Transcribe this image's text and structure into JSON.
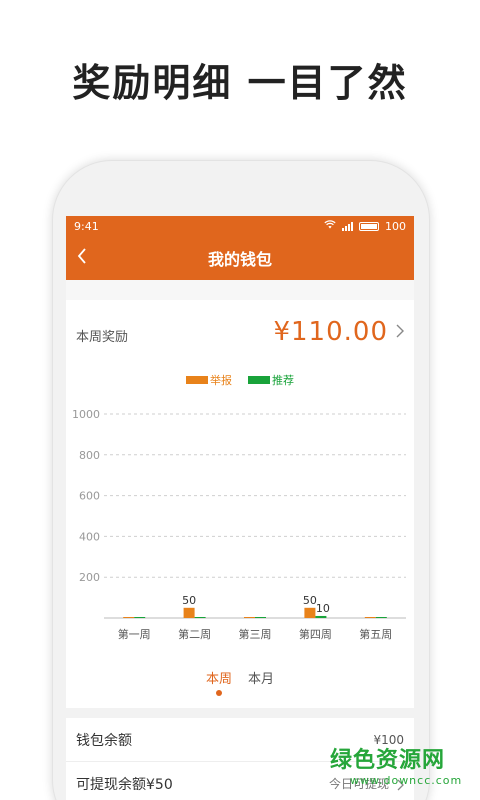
{
  "headline": "奖励明细 一目了然",
  "status_bar": {
    "time": "9:41",
    "battery": "100"
  },
  "nav": {
    "title": "我的钱包"
  },
  "reward": {
    "label": "本周奖励",
    "amount": "¥110.00"
  },
  "chart_data": {
    "type": "bar",
    "categories": [
      "第一周",
      "第二周",
      "第三周",
      "第四周",
      "第五周"
    ],
    "series": [
      {
        "name": "举报",
        "values": [
          0,
          50,
          0,
          50,
          0
        ],
        "color": "#e8821a"
      },
      {
        "name": "推荐",
        "values": [
          0,
          0,
          0,
          10,
          0
        ],
        "color": "#19a33a"
      }
    ],
    "data_labels": [
      {
        "series": 0,
        "index": 1,
        "text": "50"
      },
      {
        "series": 0,
        "index": 3,
        "text": "50"
      },
      {
        "series": 1,
        "index": 3,
        "text": "10"
      }
    ],
    "yticks": [
      200,
      400,
      600,
      800,
      1000
    ],
    "ylim": [
      0,
      1000
    ],
    "grid": true,
    "legend_position": "top-center"
  },
  "tabs": [
    {
      "label": "本周",
      "active": true
    },
    {
      "label": "本月",
      "active": false
    }
  ],
  "wallet": {
    "balance_label": "钱包余额",
    "balance_value": "¥100",
    "withdrawable_label": "可提现余额¥50",
    "withdraw_hint": "今日可提现"
  },
  "watermark": {
    "logo": "绿色资源网",
    "url": "www.downcc.com"
  },
  "colors": {
    "accent": "#e0661d",
    "series_1": "#e8821a",
    "series_2": "#19a33a"
  }
}
